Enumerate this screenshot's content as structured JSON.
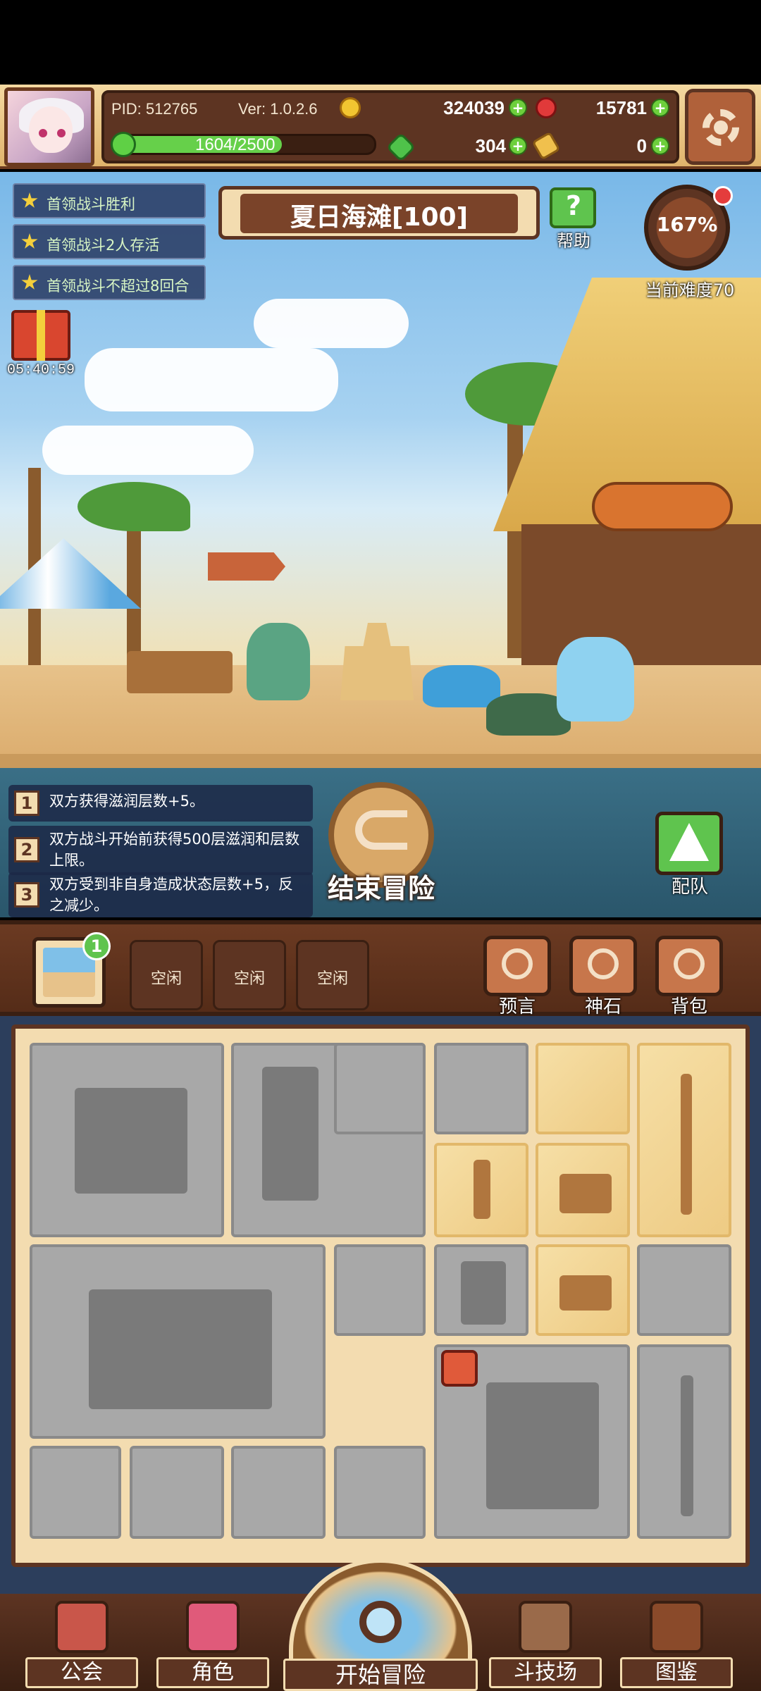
{
  "player": {
    "pid": "PID: 512765",
    "version": "Ver: 1.0.2.6",
    "coins": "324039",
    "gems": "15781",
    "clovers": "304",
    "scrolls": "0",
    "exp_text": "1604/2500",
    "exp_fraction": 0.6416
  },
  "quests": [
    "首领战斗胜利",
    "首领战斗2人存活",
    "首领战斗不超过8回合"
  ],
  "stage": {
    "title": "夏日海滩[100]",
    "help_label": "帮助",
    "difficulty_percent": "167%",
    "difficulty_label": "当前难度70",
    "gift_timer": "05:40:59"
  },
  "effects": [
    {
      "num": "1",
      "text": "双方获得滋润层数+5。"
    },
    {
      "num": "2",
      "text": "双方战斗开始前获得500层滋润和层数上限。"
    },
    {
      "num": "3",
      "text": "双方受到非自身造成状态层数+5，反之减少。"
    }
  ],
  "actions": {
    "end_adventure": "结束冒险",
    "team": "配队"
  },
  "slots": {
    "badge": "1",
    "idle": [
      "空闲",
      "空闲",
      "空闲"
    ],
    "buttons": [
      "预言",
      "神石",
      "背包"
    ]
  },
  "nav": {
    "guild": "公会",
    "character": "角色",
    "start": "开始冒险",
    "arena": "斗技场",
    "codex": "图鉴"
  },
  "colors": {
    "hud_bg": "#5d3422",
    "accent_green": "#5fc44e",
    "frame_cream": "#f3dcb0"
  }
}
